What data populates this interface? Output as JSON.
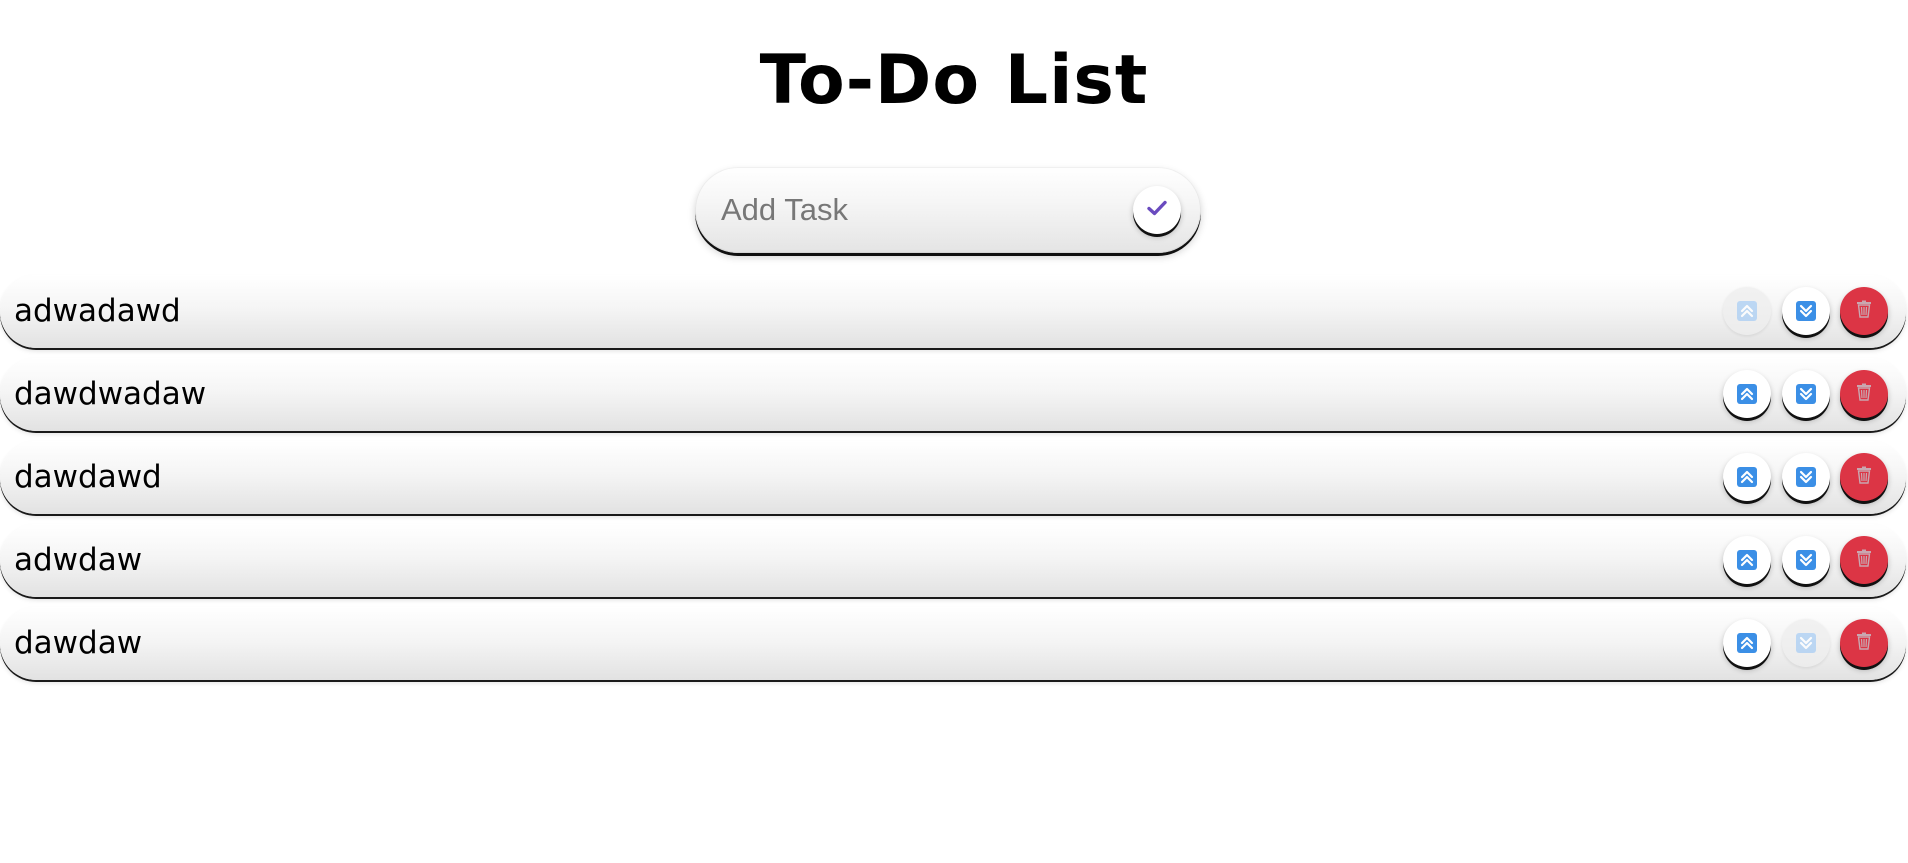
{
  "app": {
    "title": "To-Do List"
  },
  "add_task": {
    "placeholder": "Add Task",
    "value": "",
    "submit_icon": "check-icon"
  },
  "tasks": [
    {
      "text": "adwadawd",
      "up_enabled": false,
      "down_enabled": true
    },
    {
      "text": "dawdwadaw",
      "up_enabled": true,
      "down_enabled": true
    },
    {
      "text": "dawdawd",
      "up_enabled": true,
      "down_enabled": true
    },
    {
      "text": "adwdaw",
      "up_enabled": true,
      "down_enabled": true
    },
    {
      "text": "dawdaw",
      "up_enabled": true,
      "down_enabled": false
    }
  ],
  "icons": {
    "move_up": "double-chevron-up-icon",
    "move_down": "double-chevron-down-icon",
    "delete": "trash-icon"
  },
  "colors": {
    "accent_check": "#6a4bbf",
    "arrow_blue": "#3b8fe6",
    "delete_red": "#dc3545"
  }
}
